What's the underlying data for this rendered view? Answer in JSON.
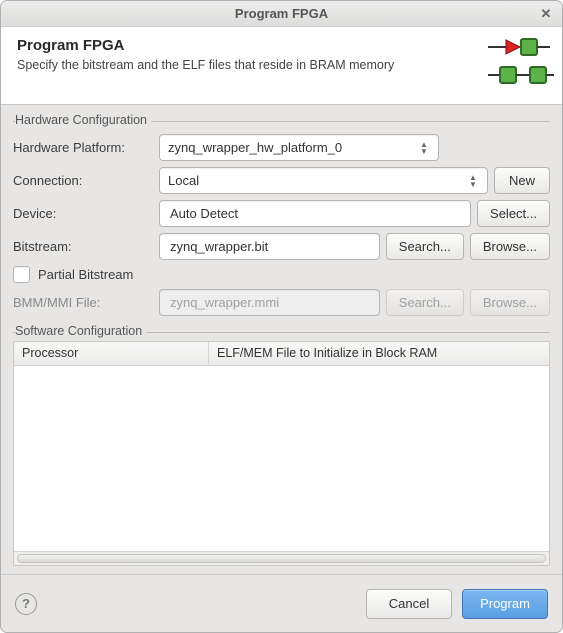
{
  "window": {
    "title": "Program FPGA"
  },
  "header": {
    "title": "Program FPGA",
    "description": "Specify the bitstream and the ELF files that reside in BRAM memory"
  },
  "hardware": {
    "group_label": "Hardware Configuration",
    "platform_label": "Hardware Platform:",
    "platform_value": "zynq_wrapper_hw_platform_0",
    "connection_label": "Connection:",
    "connection_value": "Local",
    "connection_new": "New",
    "device_label": "Device:",
    "device_value": "Auto Detect",
    "device_select": "Select...",
    "bitstream_label": "Bitstream:",
    "bitstream_value": "zynq_wrapper.bit",
    "search": "Search...",
    "browse": "Browse...",
    "partial_label": "Partial Bitstream",
    "bmm_label": "BMM/MMI File:",
    "bmm_placeholder": "zynq_wrapper.mmi"
  },
  "software": {
    "group_label": "Software Configuration",
    "col_processor": "Processor",
    "col_elf": "ELF/MEM File to Initialize in Block RAM"
  },
  "footer": {
    "cancel": "Cancel",
    "program": "Program"
  }
}
